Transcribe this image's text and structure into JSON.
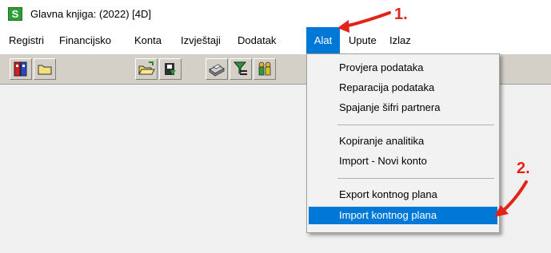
{
  "window": {
    "title": "Glavna knjiga: (2022) [4D]",
    "icon": "app-logo-icon"
  },
  "menubar": {
    "items": [
      {
        "label": "Registri"
      },
      {
        "label": "Financijsko"
      },
      {
        "label": "Konta"
      },
      {
        "label": "Izvještaji"
      },
      {
        "label": "Dodatak"
      },
      {
        "label": "Alat",
        "active": true
      },
      {
        "label": "Upute"
      },
      {
        "label": "Izlaz"
      }
    ]
  },
  "toolbar": {
    "buttons": [
      {
        "icon": "binders-icon"
      },
      {
        "icon": "folder-icon"
      },
      {
        "icon": "open-folder-icon"
      },
      {
        "icon": "save-disk-icon"
      },
      {
        "icon": "printer-icon"
      },
      {
        "icon": "filter-sum-icon"
      },
      {
        "icon": "users-icon"
      }
    ]
  },
  "dropdown": {
    "items": [
      {
        "label": "Provjera podataka"
      },
      {
        "label": "Reparacija podataka"
      },
      {
        "label": "Spajanje šifri partnera"
      },
      {
        "label": "Kopiranje analitika"
      },
      {
        "label": "Import - Novi konto"
      },
      {
        "label": "Export kontnog plana"
      },
      {
        "label": "Import kontnog plana",
        "highlighted": true
      }
    ]
  },
  "annotations": {
    "step1": "1.",
    "step2": "2.",
    "color": "#e2231a"
  },
  "colors": {
    "highlight": "#0078d7",
    "toolbar_bg": "#d4d0c8",
    "workspace_bg": "#f0f0f0"
  }
}
